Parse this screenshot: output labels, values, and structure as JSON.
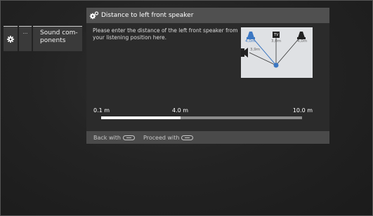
{
  "left_menu": {
    "gear_icon": "gear-icon",
    "dots_label": "···",
    "sound_components_label": "Sound com-\nponents"
  },
  "dialog": {
    "title_icon": "gears-icon",
    "title": "Distance to left front speaker",
    "instruction": "Please enter the distance of the left front speaker from your listening position here.",
    "diagram": {
      "labels": {
        "front_left_distance": "4,0m",
        "tv_distance": "3,0m",
        "front_right_distance": "4,0m",
        "side_left_distance": "3,9m",
        "tv_label": "TV"
      },
      "highlight_color": "#3b77c2"
    },
    "slider": {
      "min_label": "0.1 m",
      "current_label": "4.0 m",
      "max_label": "10.0 m",
      "min": 0.1,
      "max": 10.0,
      "value": 4.0
    },
    "footer": {
      "back_label": "Back with",
      "back_icon": "back-button-icon",
      "proceed_label": "Proceed with",
      "proceed_icon": "forward-button-icon"
    }
  }
}
